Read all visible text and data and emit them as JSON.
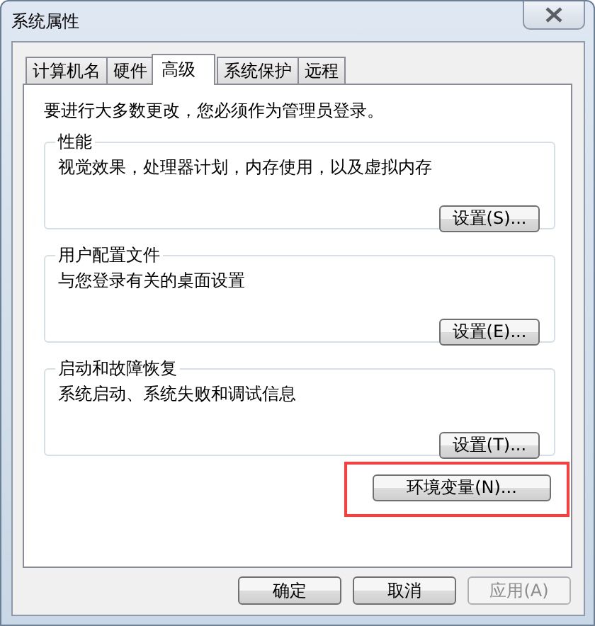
{
  "window": {
    "title": "系统属性"
  },
  "tabs": [
    {
      "label": "计算机名",
      "selected": false
    },
    {
      "label": "硬件",
      "selected": false
    },
    {
      "label": "高级",
      "selected": true
    },
    {
      "label": "系统保护",
      "selected": false
    },
    {
      "label": "远程",
      "selected": false
    }
  ],
  "notice": "要进行大多数更改，您必须作为管理员登录。",
  "groups": [
    {
      "title": "性能",
      "description": "视觉效果，处理器计划，内存使用，以及虚拟内存",
      "button": "设置(S)..."
    },
    {
      "title": "用户配置文件",
      "description": "与您登录有关的桌面设置",
      "button": "设置(E)..."
    },
    {
      "title": "启动和故障恢复",
      "description": "系统启动、系统失败和调试信息",
      "button": "设置(T)..."
    }
  ],
  "env_button": {
    "label": "环境变量(N)...",
    "highlighted": true
  },
  "buttons": [
    {
      "label": "确定",
      "disabled": false
    },
    {
      "label": "取消",
      "disabled": false
    },
    {
      "label": "应用(A)",
      "disabled": true
    }
  ]
}
